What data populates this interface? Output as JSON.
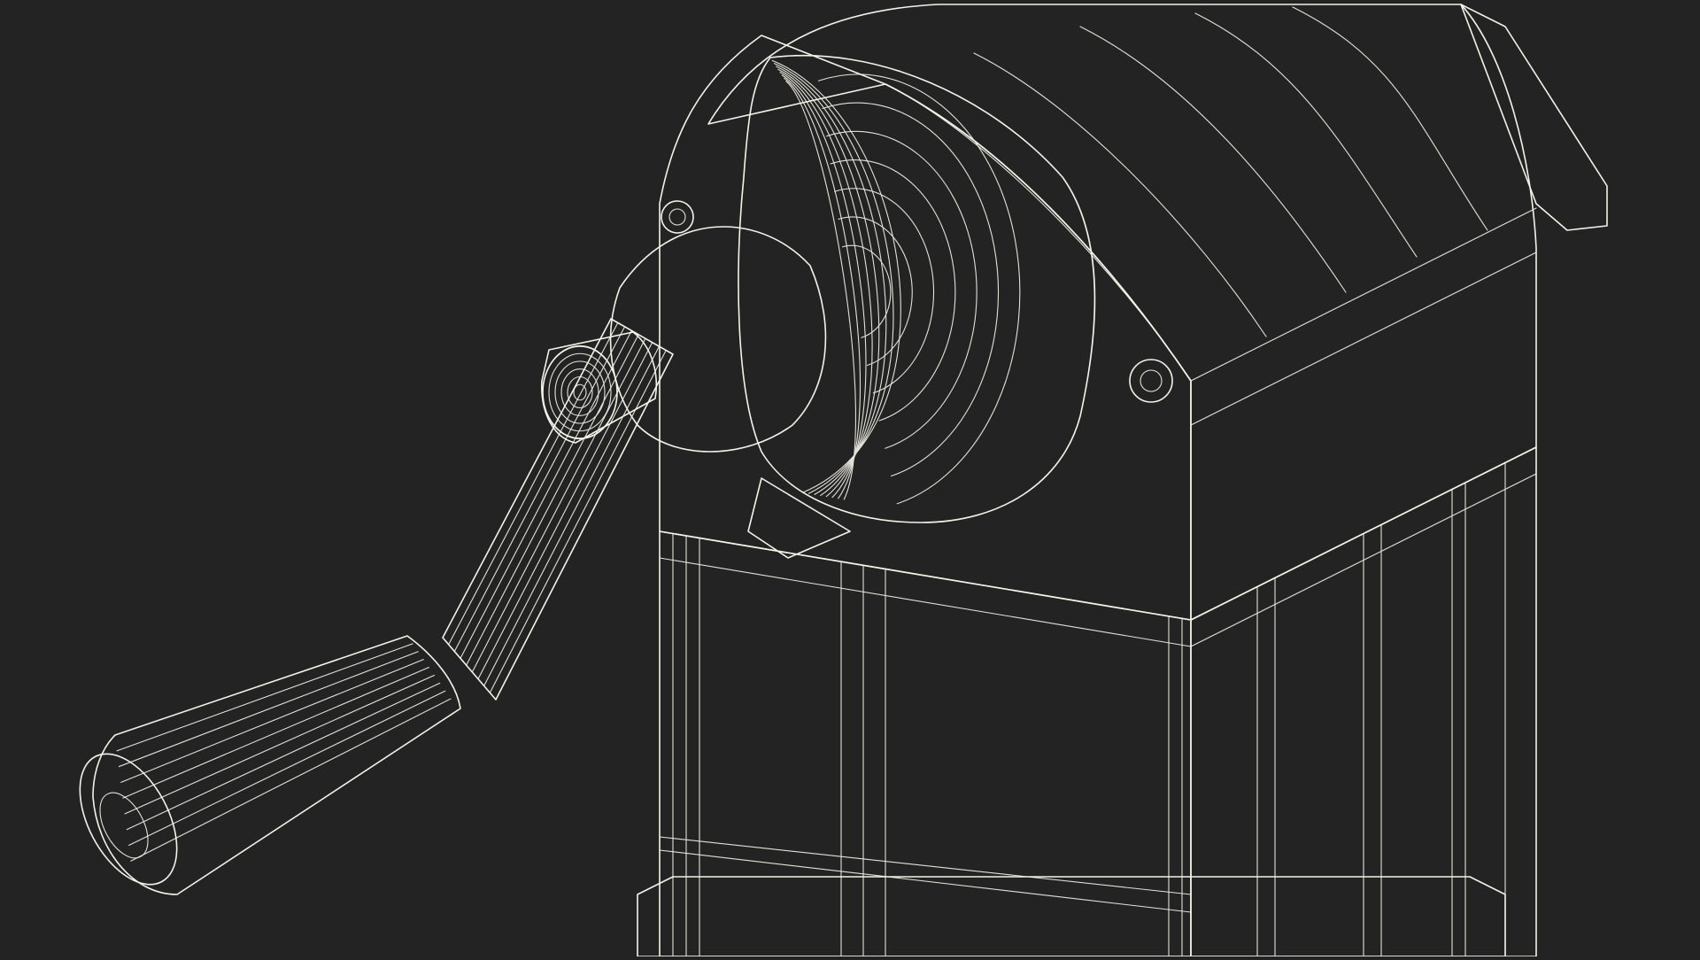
{
  "scene": {
    "subject": "pencil-sharpener-wireframe-render",
    "colors": {
      "background": "#232323",
      "mesh_fill": "#767767",
      "mesh_fill_dark": "#5f6056",
      "mesh_fill_light": "#8a8b7c",
      "wire": "#f4f3e8"
    }
  }
}
